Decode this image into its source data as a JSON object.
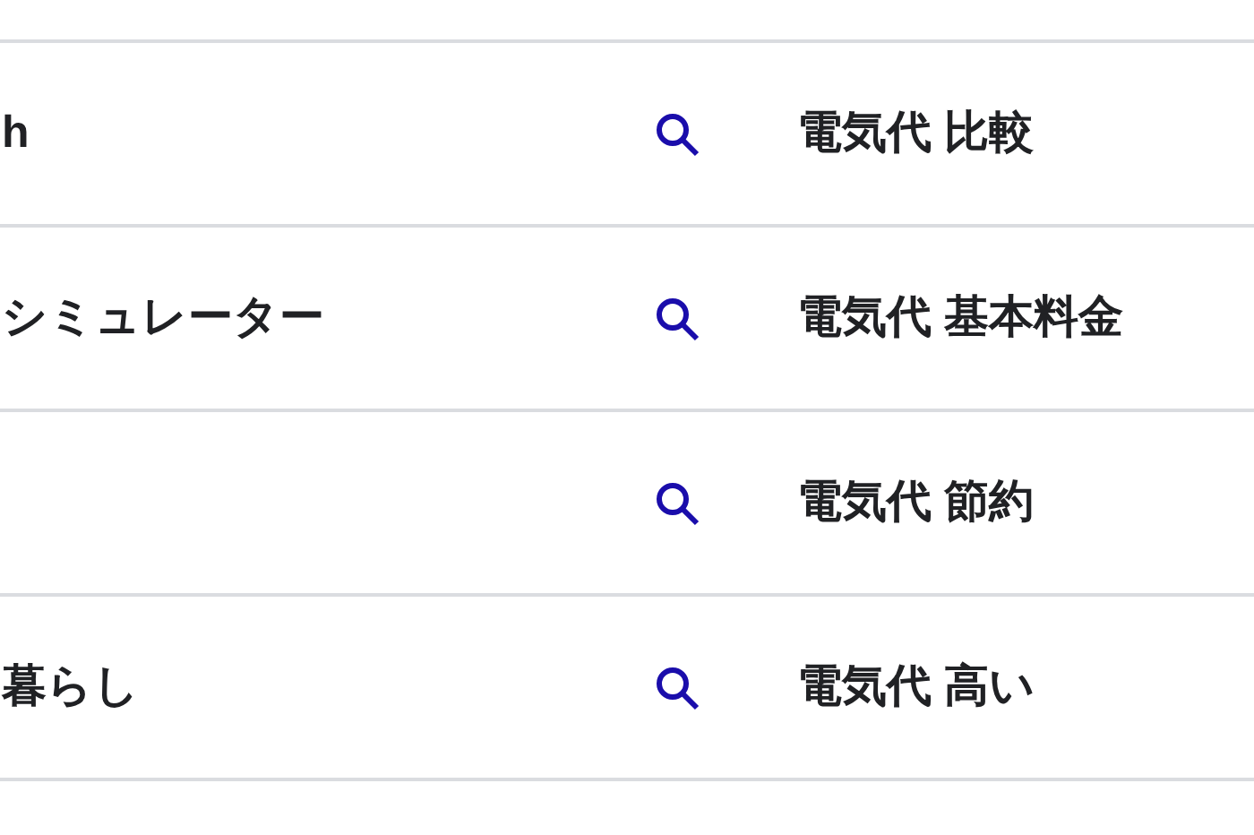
{
  "related_searches": [
    {
      "left": "h",
      "right": "電気代 比較"
    },
    {
      "left": "シミュレーター",
      "right": "電気代 基本料金"
    },
    {
      "right": "電気代 節約"
    },
    {
      "left": "暮らし",
      "right": "電気代 高い"
    }
  ]
}
